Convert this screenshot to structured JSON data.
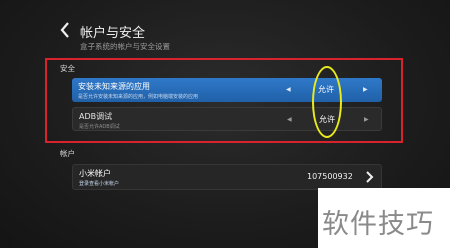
{
  "header": {
    "title": "帐户与安全",
    "subtitle": "盒子系统的帐户与安全设置"
  },
  "security": {
    "section_label": "安全",
    "rows": [
      {
        "label": "安装未知来源的应用",
        "desc": "是否允许安装未知来源的应用，例如电脑端安装的应用",
        "value": "允许",
        "selected": true
      },
      {
        "label": "ADB调试",
        "desc": "是否允许ADB调试",
        "value": "允许",
        "selected": false
      }
    ]
  },
  "account": {
    "section_label": "帐户",
    "row": {
      "label": "小米帐户",
      "desc": "登录查看小米帐户",
      "value": "107500932"
    }
  },
  "watermark": "软件技巧",
  "colors": {
    "highlight": "#2a6fbf",
    "annotation_box": "#d8232f",
    "annotation_ellipse": "#e8ea1c"
  }
}
